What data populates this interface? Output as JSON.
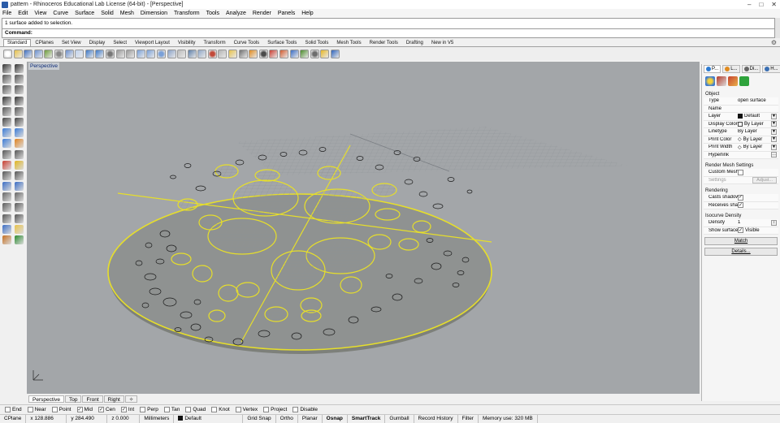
{
  "window": {
    "title": "pattern - Rhinoceros Educational Lab License (64-bit) - [Perspective]"
  },
  "menu": [
    "File",
    "Edit",
    "View",
    "Curve",
    "Surface",
    "Solid",
    "Mesh",
    "Dimension",
    "Transform",
    "Tools",
    "Analyze",
    "Render",
    "Panels",
    "Help"
  ],
  "command": {
    "history": "1 surface added to selection.",
    "prompt": "Command:"
  },
  "toolbar_tabs": [
    "Standard",
    "CPlanes",
    "Set View",
    "Display",
    "Select",
    "Viewport Layout",
    "Visibility",
    "Transform",
    "Curve Tools",
    "Surface Tools",
    "Solid Tools",
    "Mesh Tools",
    "Render Tools",
    "Drafting",
    "New in V5"
  ],
  "toolbar_icons": [
    "new-file-icon",
    "open-file-icon",
    "save-icon",
    "print-icon",
    "import-icon",
    "cut-icon",
    "copy-icon",
    "paste-icon",
    "undo-icon",
    "redo-icon",
    "pan-icon",
    "rotate-view-icon",
    "zoom-dynamic-icon",
    "zoom-window-icon",
    "zoom-extents-icon",
    "zoom-selected-icon",
    "undo-view-icon",
    "four-views-icon",
    "grid-icon",
    "cplane-icon",
    "select-points-icon",
    "named-views-icon",
    "show-icon",
    "lock-icon",
    "layer-icon",
    "render-icon",
    "properties-icon",
    "material-icon",
    "environment-icon",
    "render-preview-icon",
    "options-icon",
    "sun-icon",
    "help-icon"
  ],
  "viewport": {
    "label": "Perspective",
    "tabs": [
      "Perspective",
      "Top",
      "Front",
      "Right"
    ]
  },
  "properties": {
    "tabs": [
      "P...",
      "L...",
      "Di...",
      "H..."
    ],
    "section_object": "Object",
    "rows": [
      {
        "label": "Type",
        "value": "open surface"
      },
      {
        "label": "Name",
        "value": ""
      },
      {
        "label": "Layer",
        "value": "Default"
      },
      {
        "label": "Display Color",
        "value": "By Layer"
      },
      {
        "label": "Linetype",
        "value": "By Layer"
      },
      {
        "label": "Print Color",
        "value": "By Layer"
      },
      {
        "label": "Print Width",
        "value": "By Layer"
      },
      {
        "label": "Hyperlink",
        "value": ""
      }
    ],
    "section_mesh": "Render Mesh Settings",
    "custom_mesh": "Custom Mesh",
    "settings": "Settings",
    "adjust": "Adjust...",
    "section_rendering": "Rendering",
    "casts_shadows": "Casts shadows",
    "receives_shadows": "Receives sha...",
    "section_isocurve": "Isocurve Density",
    "density_label": "Density",
    "density_value": "1",
    "show_surface": "Show surface ...",
    "visible": "Visible",
    "match": "Match",
    "details": "Details..."
  },
  "osnaps": [
    {
      "label": "End",
      "checked": false
    },
    {
      "label": "Near",
      "checked": false
    },
    {
      "label": "Point",
      "checked": false
    },
    {
      "label": "Mid",
      "checked": true
    },
    {
      "label": "Cen",
      "checked": true
    },
    {
      "label": "Int",
      "checked": true
    },
    {
      "label": "Perp",
      "checked": false
    },
    {
      "label": "Tan",
      "checked": false
    },
    {
      "label": "Quad",
      "checked": false
    },
    {
      "label": "Knot",
      "checked": false
    },
    {
      "label": "Vertex",
      "checked": false
    },
    {
      "label": "Project",
      "checked": false
    },
    {
      "label": "Disable",
      "checked": false
    }
  ],
  "status": {
    "cplane": "CPlane",
    "x": "x 128.886",
    "y": "y 284.490",
    "z": "z 0.000",
    "units": "Millimeters",
    "layer": "Default",
    "grid_snap": "Grid Snap",
    "ortho": "Ortho",
    "planar": "Planar",
    "osnap": "Osnap",
    "smarttrack": "SmartTrack",
    "gumball": "Gumball",
    "record_history": "Record History",
    "filter": "Filter",
    "memory": "Memory use: 320 MB"
  }
}
